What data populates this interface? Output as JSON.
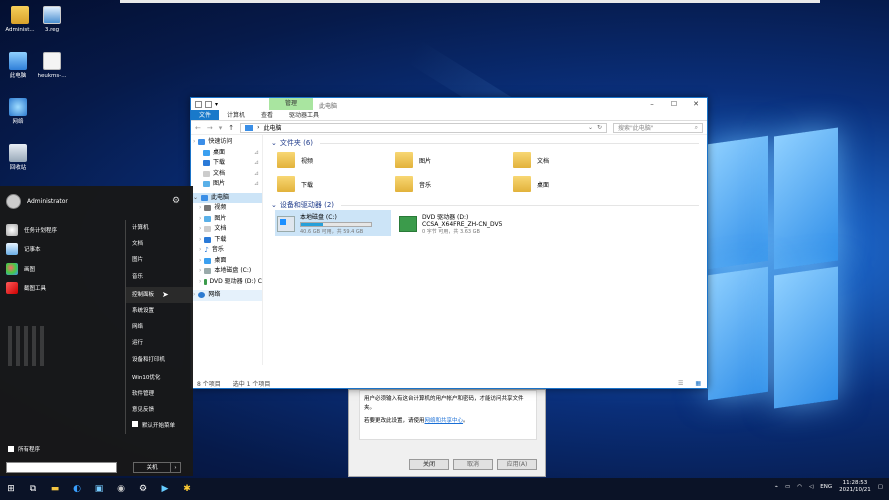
{
  "desktop": {
    "icons": [
      {
        "label": "Administ...",
        "icon": "user-folder-icon"
      },
      {
        "label": "3.reg",
        "icon": "reg-file-icon"
      },
      {
        "label": "此电脑",
        "icon": "this-pc-icon"
      },
      {
        "label": "heukms-...",
        "icon": "file-icon"
      },
      {
        "label": "网络",
        "icon": "network-icon"
      },
      {
        "label": "回收站",
        "icon": "recycle-bin-icon"
      }
    ]
  },
  "explorer": {
    "tab_manage": "管理",
    "title": "此电脑",
    "ribbon": [
      "文件",
      "计算机",
      "查看",
      "驱动器工具"
    ],
    "address": "此电脑",
    "search_placeholder": "搜索\"此电脑\"",
    "nav": [
      {
        "label": "快速访问",
        "icon": "star-icon"
      },
      {
        "label": "桌面",
        "icon": "desktop-icon"
      },
      {
        "label": "下载",
        "icon": "download-icon"
      },
      {
        "label": "文档",
        "icon": "document-icon"
      },
      {
        "label": "图片",
        "icon": "picture-icon"
      },
      {
        "label": "此电脑",
        "icon": "this-pc-icon"
      },
      {
        "label": "视频",
        "icon": "video-icon"
      },
      {
        "label": "图片",
        "icon": "picture-icon"
      },
      {
        "label": "文档",
        "icon": "document-icon"
      },
      {
        "label": "下载",
        "icon": "download-icon"
      },
      {
        "label": "音乐",
        "icon": "music-icon"
      },
      {
        "label": "桌面",
        "icon": "desktop-icon"
      },
      {
        "label": "本地磁盘 (C:)",
        "icon": "drive-icon"
      },
      {
        "label": "DVD 驱动器 (D:) C",
        "icon": "dvd-icon"
      },
      {
        "label": "网络",
        "icon": "network-icon"
      }
    ],
    "folders_header": "文件夹 (6)",
    "folders": [
      "视频",
      "图片",
      "文档",
      "下载",
      "音乐",
      "桌面"
    ],
    "drives_header": "设备和驱动器 (2)",
    "drives": [
      {
        "name": "本地磁盘 (C:)",
        "detail": "40.6 GB 可用，共 59.4 GB",
        "used_fraction": 0.32
      },
      {
        "name": "DVD 驱动器 (D:)",
        "sub": "CCSA_X64FRE_ZH-CN_DV5",
        "detail": "0 字节 可用，共 3.63 GB"
      }
    ],
    "status_items": "8 个项目",
    "status_selected": "选中 1 个项目"
  },
  "dialog": {
    "line1": "用户必须输入有这台计算机的用户帐户和密码，才能访问共享文件夹。",
    "line2_prefix": "若要更改此设置，请使用",
    "line2_link": "网络和共享中心",
    "line2_suffix": "。",
    "buttons": [
      "关闭",
      "取消",
      "应用(A)"
    ]
  },
  "start_menu": {
    "user": "Administrator",
    "pinned": [
      {
        "label": "任务计划程序",
        "icon": "task-scheduler-icon"
      },
      {
        "label": "记事本",
        "icon": "notepad-icon"
      },
      {
        "label": "画图",
        "icon": "paint-icon"
      },
      {
        "label": "截图工具",
        "icon": "snipping-tool-icon"
      }
    ],
    "right_items": [
      "计算机",
      "文档",
      "图片",
      "音乐",
      "控制面板",
      "系统设置",
      "网络",
      "运行",
      "设备和打印机",
      "Win10优化",
      "软件管理",
      "意见反馈",
      "默认开始菜单"
    ],
    "all_programs": "所有程序",
    "shutdown": "关机"
  },
  "taskbar": {
    "apps": [
      "start-icon",
      "task-view-icon",
      "explorer-icon",
      "edge-icon",
      "taskmanager-icon",
      "browser-icon",
      "settings-icon",
      "media-icon",
      "app-icon"
    ],
    "lang": "ENG",
    "time": "11:28:53",
    "date": "2021/10/21"
  }
}
